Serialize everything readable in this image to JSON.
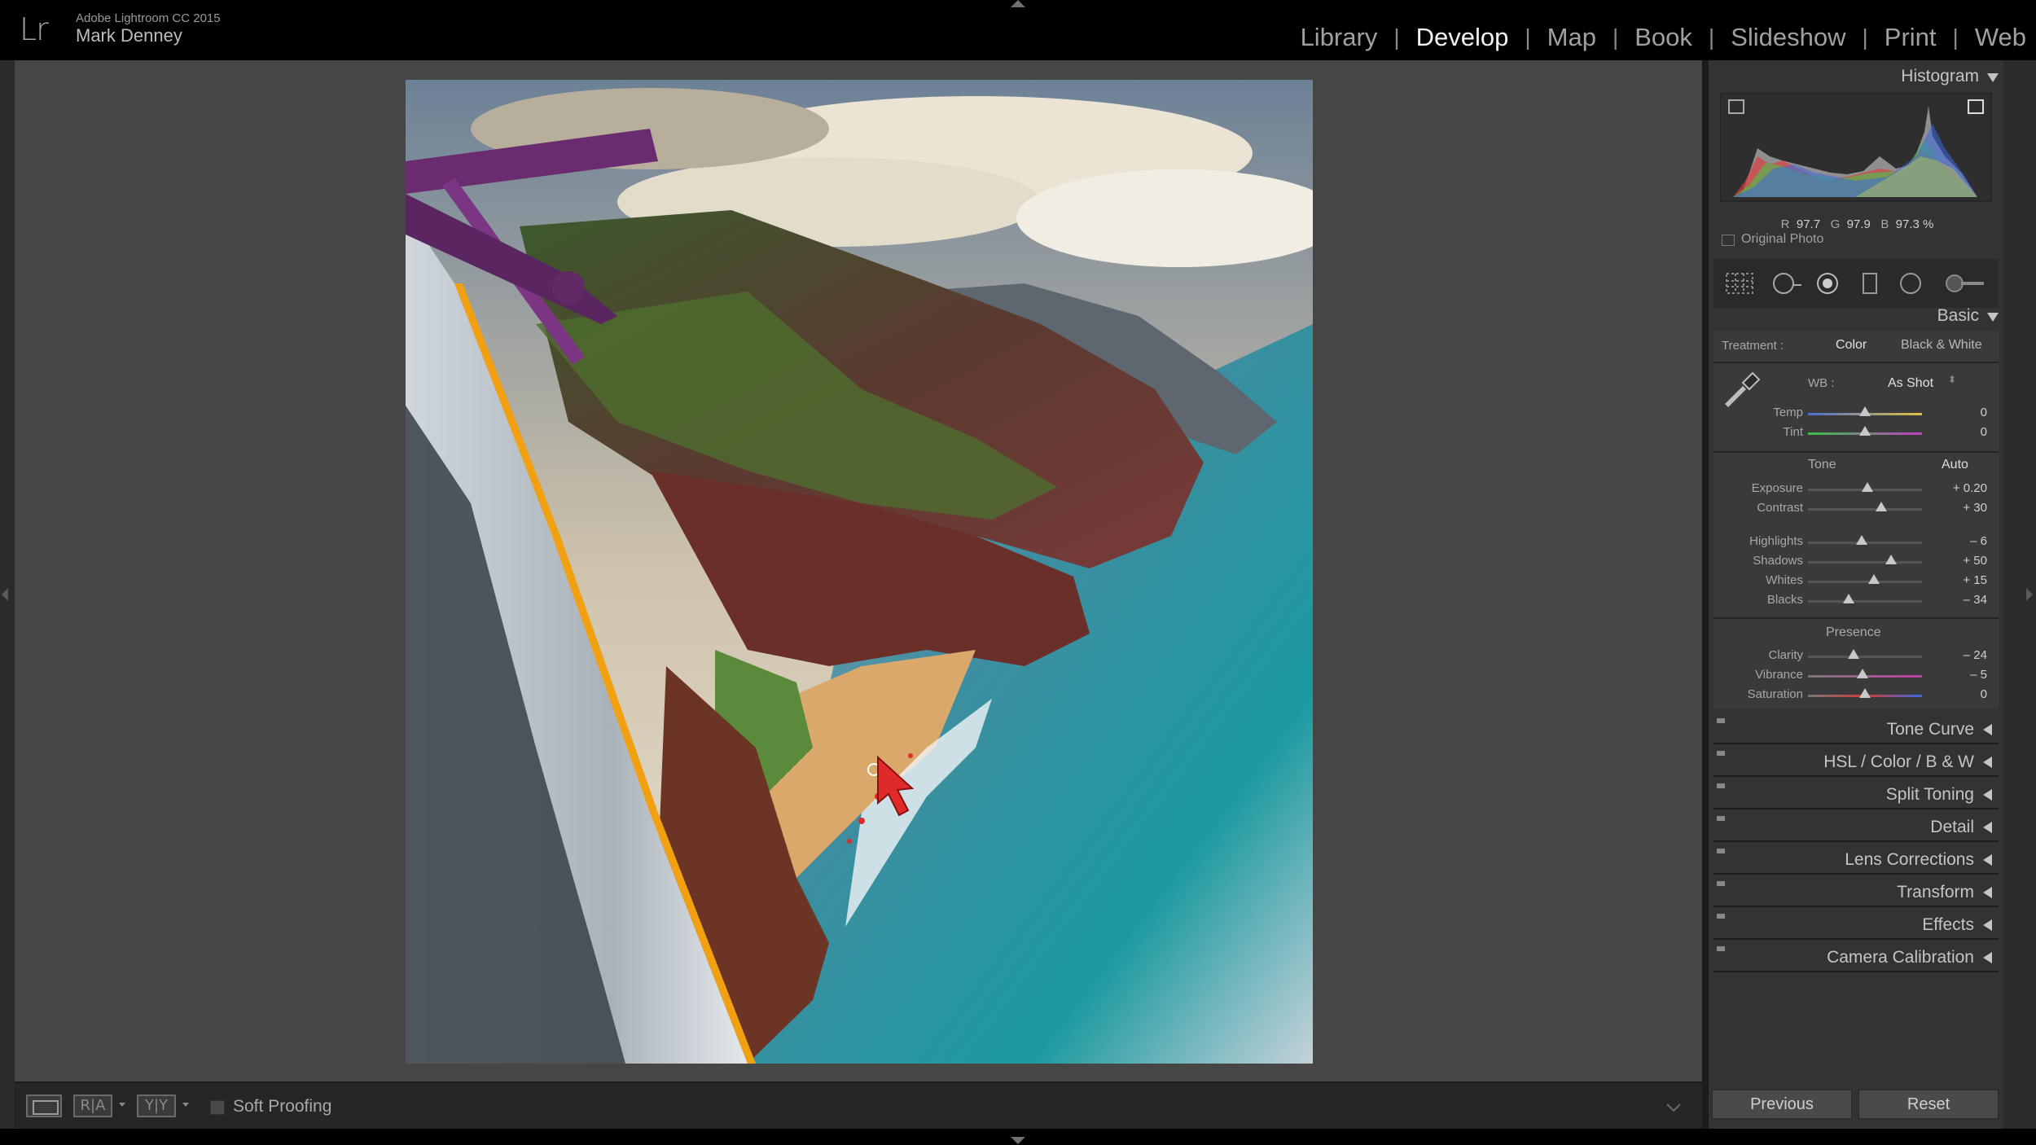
{
  "app": {
    "version": "Adobe Lightroom CC 2015",
    "user": "Mark Denney"
  },
  "modules": [
    {
      "label": "Library",
      "active": false
    },
    {
      "label": "Develop",
      "active": true
    },
    {
      "label": "Map",
      "active": false
    },
    {
      "label": "Book",
      "active": false
    },
    {
      "label": "Slideshow",
      "active": false
    },
    {
      "label": "Print",
      "active": false
    },
    {
      "label": "Web",
      "active": false
    }
  ],
  "module_separator": "|",
  "toolbar": {
    "soft_proofing_label": "Soft Proofing",
    "view_ba_glyph": "R|A",
    "view_yy_glyph": "Y|Y"
  },
  "histogram": {
    "title": "Histogram",
    "r_label": "R",
    "r_value": "97.7",
    "g_label": "G",
    "g_value": "97.9",
    "b_label": "B",
    "b_value": "97.3 %",
    "original_photo_label": "Original Photo"
  },
  "basic": {
    "title": "Basic",
    "treatment_label": "Treatment :",
    "treatment_color": "Color",
    "treatment_bw": "Black & White",
    "wb_label": "WB :",
    "wb_value": "As Shot",
    "tone_label": "Tone",
    "auto_label": "Auto",
    "presence_label": "Presence",
    "sliders": {
      "temp": {
        "label": "Temp",
        "value": "0",
        "pos": 0.5
      },
      "tint": {
        "label": "Tint",
        "value": "0",
        "pos": 0.5
      },
      "exposure": {
        "label": "Exposure",
        "value": "+ 0.20",
        "pos": 0.52
      },
      "contrast": {
        "label": "Contrast",
        "value": "+ 30",
        "pos": 0.64
      },
      "highlights": {
        "label": "Highlights",
        "value": "– 6",
        "pos": 0.47
      },
      "shadows": {
        "label": "Shadows",
        "value": "+ 50",
        "pos": 0.73
      },
      "whites": {
        "label": "Whites",
        "value": "+ 15",
        "pos": 0.58
      },
      "blacks": {
        "label": "Blacks",
        "value": "– 34",
        "pos": 0.36
      },
      "clarity": {
        "label": "Clarity",
        "value": "– 24",
        "pos": 0.4
      },
      "vibrance": {
        "label": "Vibrance",
        "value": "– 5",
        "pos": 0.48
      },
      "saturation": {
        "label": "Saturation",
        "value": "0",
        "pos": 0.5
      }
    }
  },
  "collapsed_panels": [
    {
      "title": "Tone Curve"
    },
    {
      "title": "HSL / Color / B & W"
    },
    {
      "title": "Split Toning"
    },
    {
      "title": "Detail"
    },
    {
      "title": "Lens Corrections"
    },
    {
      "title": "Transform"
    },
    {
      "title": "Effects"
    },
    {
      "title": "Camera Calibration"
    }
  ],
  "buttons": {
    "previous": "Previous",
    "reset": "Reset"
  },
  "icons": {
    "logo": "lr-logo",
    "crop": "crop-overlay-icon",
    "spot": "spot-removal-icon",
    "redeye": "red-eye-icon",
    "grad": "graduated-filter-icon",
    "radial": "radial-filter-icon",
    "brush": "adjustment-brush-icon",
    "eyedropper": "eyedropper-icon"
  },
  "colors": {
    "accent_active": "#f1f1f1",
    "panel_bg": "#333333",
    "canvas_bg": "#464646",
    "cursor_red": "#e02a2a"
  }
}
